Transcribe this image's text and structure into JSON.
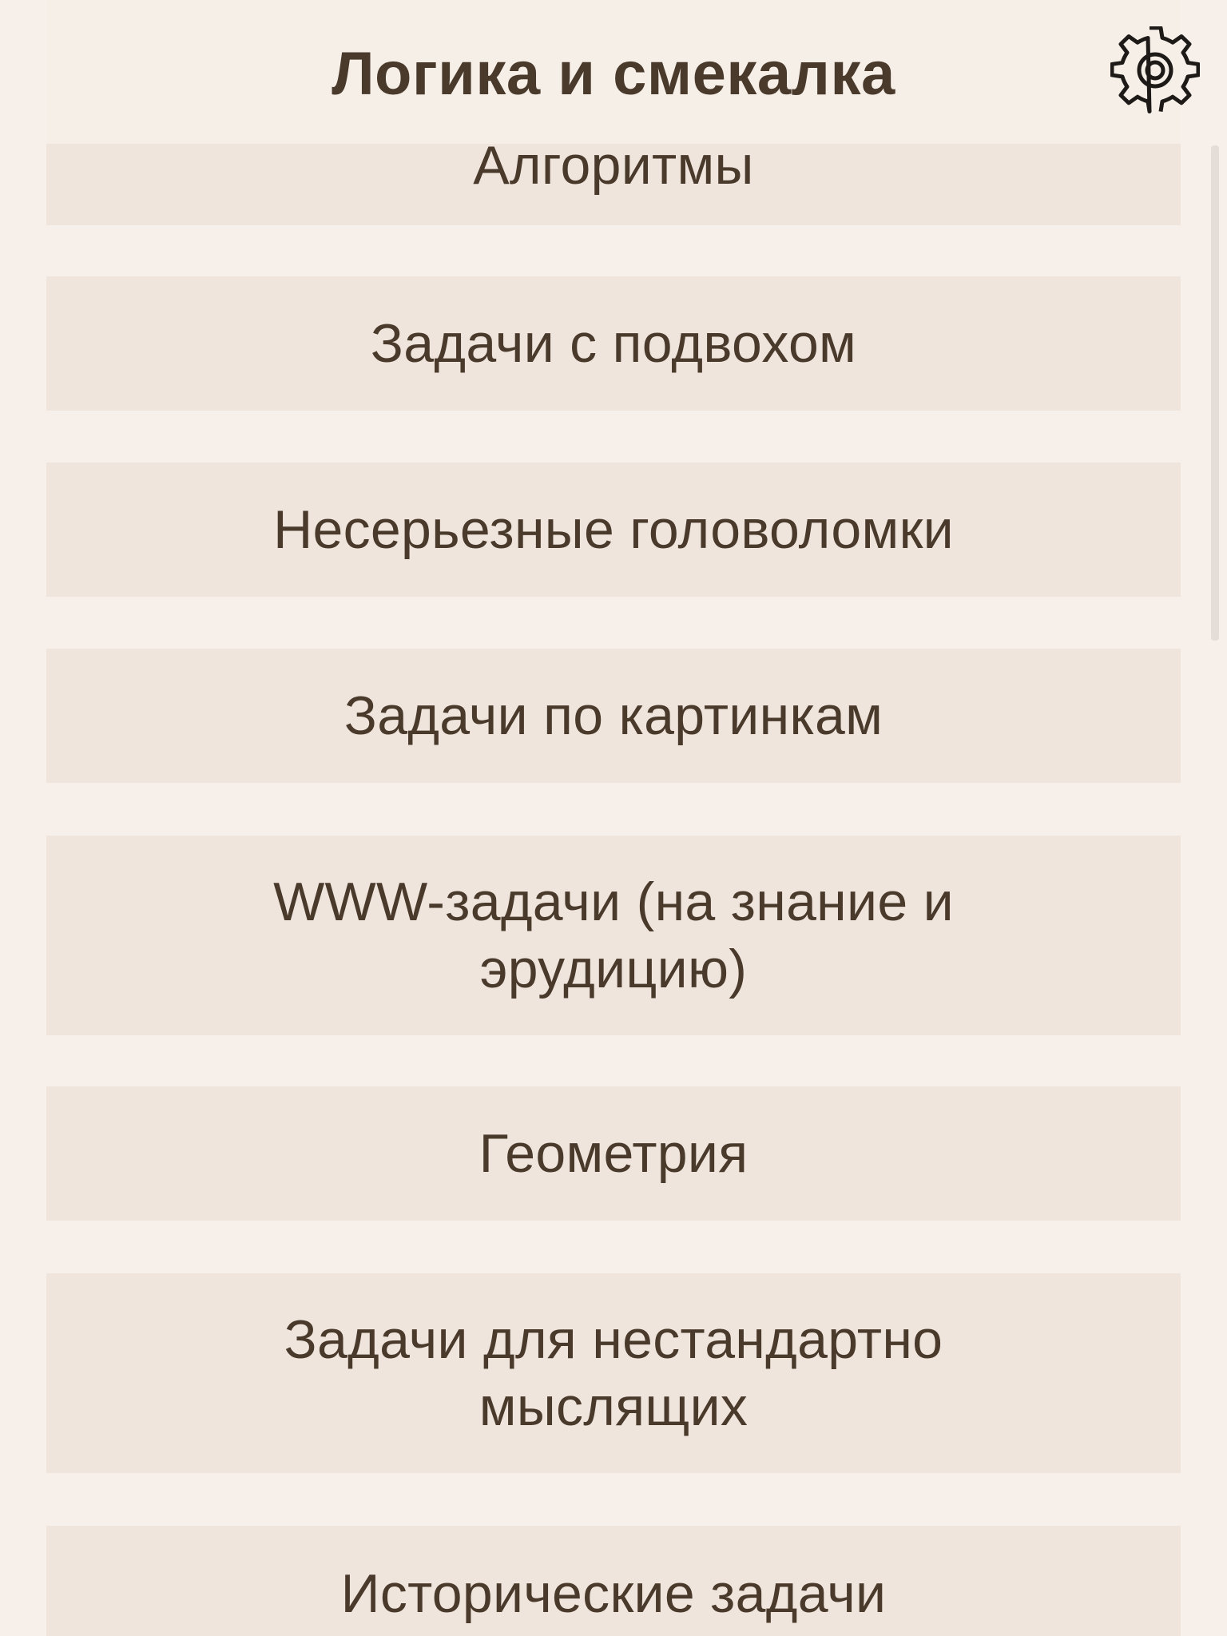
{
  "header": {
    "title": "Логика и смекалка",
    "settings_icon": "gear-icon"
  },
  "categories": [
    {
      "label": "Алгоритмы"
    },
    {
      "label": "Задачи с подвохом"
    },
    {
      "label": "Несерьезные головоломки"
    },
    {
      "label": "Задачи по картинкам"
    },
    {
      "label": "WWW-задачи (на знание и эрудицию)"
    },
    {
      "label": "Геометрия"
    },
    {
      "label": "Задачи для нестандартно мыслящих"
    },
    {
      "label": "Исторические задачи"
    }
  ],
  "colors": {
    "background": "#f7efe9",
    "item_background": "#efe5dc",
    "text": "#4a3a2c"
  }
}
